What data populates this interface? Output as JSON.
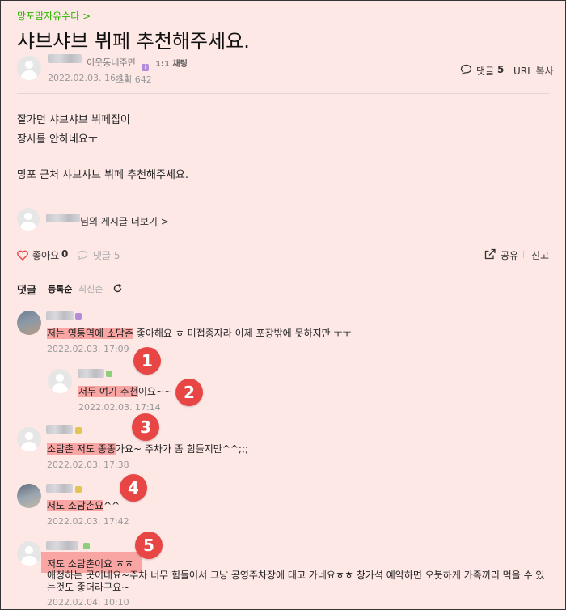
{
  "board_link": "망포맘자유수다 >",
  "post": {
    "title": "샤브샤브 뷔페 추천해주세요.",
    "author_grade": "이웃동네주민",
    "chat_label": "1:1 채팅",
    "date": "2022.02.03. 16:11",
    "views": "조회 642",
    "comment_label": "댓글",
    "comment_count": "5",
    "url_copy": "URL 복사",
    "body_lines": [
      "잘가던 샤브샤브 뷔페집이",
      "장사를 안하네요ㅜ",
      "망포 근처 샤브샤브 뷔페 추천해주세요."
    ],
    "more_posts": "님의 게시글 더보기 >"
  },
  "actions": {
    "like_label": "좋아요",
    "like_count": "0",
    "comment_label": "댓글 5",
    "share_label": "공유",
    "report_label": "신고"
  },
  "comments_header": {
    "title": "댓글",
    "sort_registered": "등록순",
    "sort_latest": "최신순"
  },
  "comments": [
    {
      "text_hl": "저는 영통역에 소담촌",
      "text_rest": " 좋아해요 ㅎ 미접종자라 이제 포장밖에 못하지만 ㅜㅜ",
      "date": "2022.02.03. 17:09",
      "marker": "1"
    },
    {
      "text_hl": "저두 여기 추천",
      "text_rest": "이요~~",
      "date": "2022.02.03. 17:14",
      "marker": "2"
    },
    {
      "text_hl": "소담촌 저도 종종",
      "text_rest": "가요~ 주차가 좀 힘들지만^^;;;",
      "date": "2022.02.03. 17:38",
      "marker": "3"
    },
    {
      "text_hl": "저도 소담촌요",
      "text_rest": "^^",
      "date": "2022.02.03. 17:42",
      "marker": "4"
    },
    {
      "text_hl": "저도 소담촌이요 ㅎㅎ",
      "text_line2": "애정하는 곳이네요~주차 너무 힘들어서 그냥 공영주차장에 대고 가네요ㅎㅎ 창가석 예약하면 오붓하게 가족끼리 먹을 수 있",
      "text_line3": "는것도 좋더라구요~",
      "date": "2022.02.04. 10:10",
      "marker": "5"
    }
  ],
  "colors": {
    "accent_green": "#2db400",
    "highlight": "#f56e6e",
    "marker_red": "#e84545",
    "background": "#fde8e6"
  }
}
